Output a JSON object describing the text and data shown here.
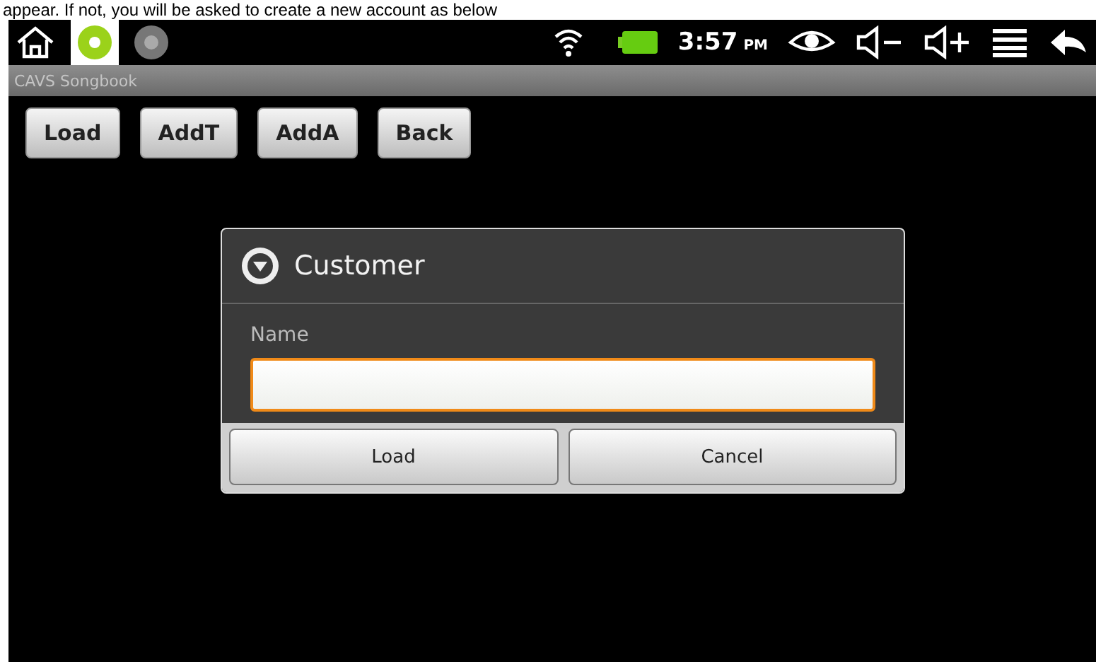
{
  "document_text": "appear. If not, you will be asked to create a new account as below",
  "status_bar": {
    "time": "3:57",
    "meridiem": "PM"
  },
  "app_bar": {
    "title": "CAVS Songbook"
  },
  "toolbar": {
    "buttons": [
      "Load",
      "AddT",
      "AddA",
      "Back"
    ]
  },
  "dialog": {
    "title": "Customer",
    "field": {
      "label": "Name",
      "focused": true
    },
    "buttons": [
      "Load",
      "Cancel"
    ]
  }
}
